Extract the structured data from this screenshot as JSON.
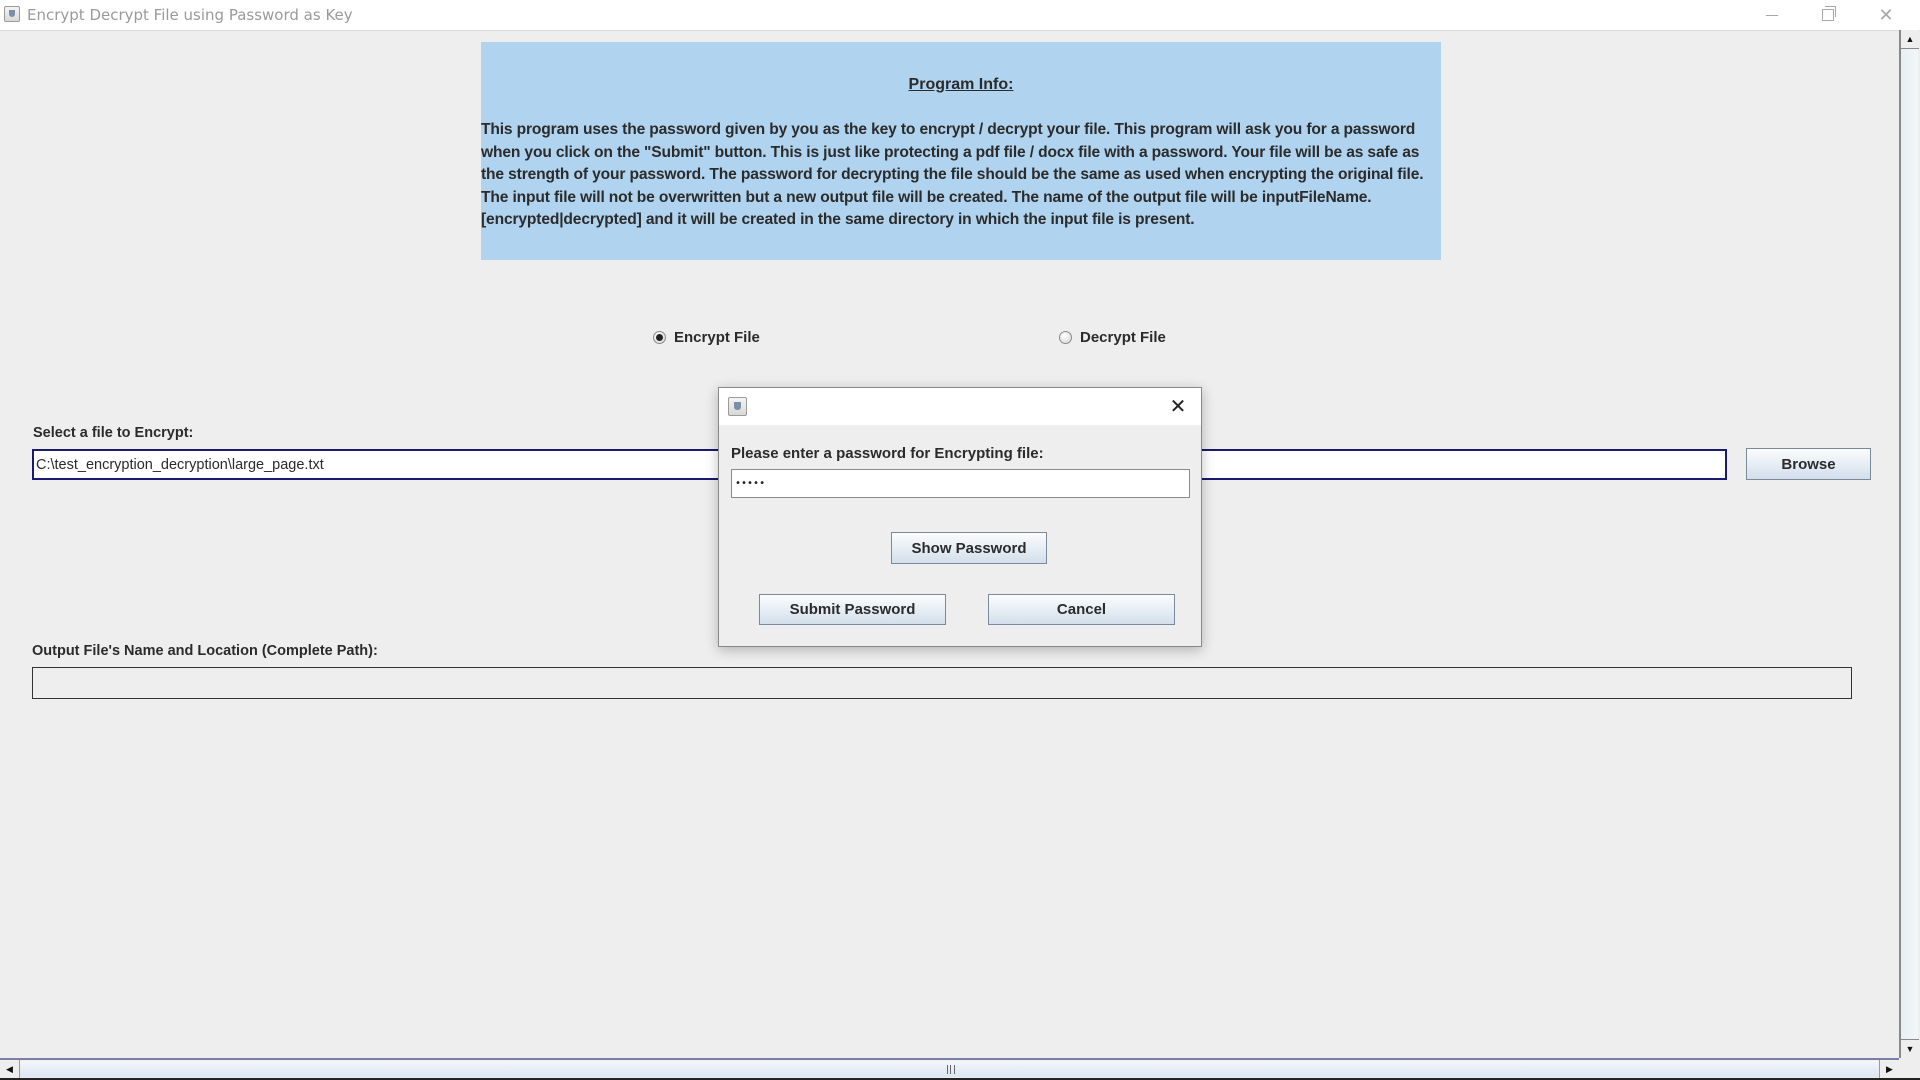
{
  "window": {
    "title": "Encrypt Decrypt File using Password as Key",
    "controls": {
      "minimize": "minimize",
      "maximize": "restore",
      "close": "close"
    }
  },
  "info": {
    "title": "Program Info:",
    "body": "This program uses the password given by you as the key to encrypt / decrypt your file. This program will ask you for a password when you click on the \"Submit\" button. This is just like protecting a pdf file / docx file with a password. Your file will be as safe as the strength of your password. The password for decrypting the file should be the same as used when encrypting the original file. The input file will not be overwritten but a new output file will be created. The name of the output file will be inputFileName.[encrypted|decrypted] and it will be created in the same directory in which the input file is present.",
    "background_color": "#b0d4ef"
  },
  "mode": {
    "options": [
      {
        "label": "Encrypt File",
        "selected": true
      },
      {
        "label": "Decrypt File",
        "selected": false
      }
    ]
  },
  "input_file": {
    "label": "Select a file to Encrypt:",
    "value": "C:\\test_encryption_decryption\\large_page.txt",
    "browse_label": "Browse"
  },
  "output_file": {
    "label": "Output File's Name and Location (Complete Path):",
    "value": ""
  },
  "dialog": {
    "title": "",
    "prompt": "Please enter a password for Encrypting file:",
    "password_masked": "•••••",
    "show_password_label": "Show Password",
    "submit_label": "Submit Password",
    "cancel_label": "Cancel",
    "close_glyph": "✕"
  },
  "scrollbars": {
    "up_glyph": "▲",
    "down_glyph": "▼",
    "left_glyph": "◀",
    "right_glyph": "▶"
  }
}
